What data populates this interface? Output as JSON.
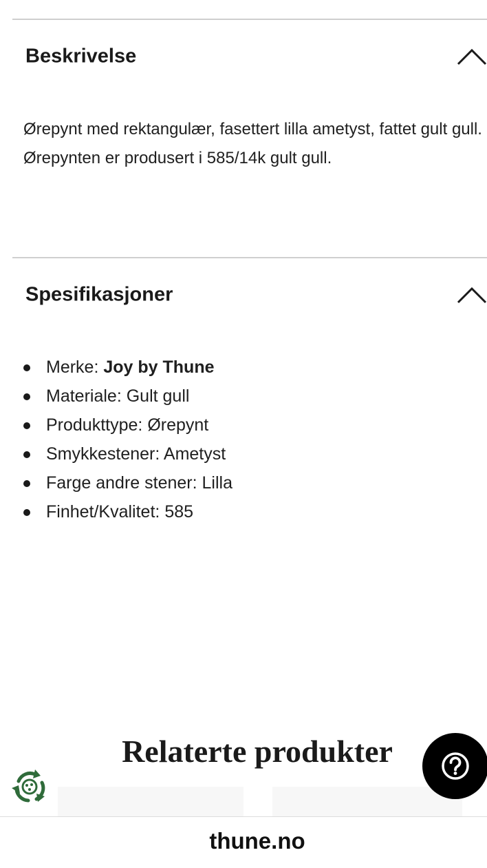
{
  "description": {
    "title": "Beskrivelse",
    "line1": "Ørepynt med rektangulær, fasettert lilla ametyst, fattet gult gull.",
    "line2": "Ørepynten er produsert i 585/14k gult gull."
  },
  "specifications": {
    "title": "Spesifikasjoner",
    "items": [
      {
        "label": "Merke: ",
        "value": "Joy by Thune"
      },
      {
        "label": "Materiale: ",
        "value": "Gult gull"
      },
      {
        "label": "Produkttype: ",
        "value": "Ørepynt"
      },
      {
        "label": "Smykkestener: ",
        "value": "Ametyst"
      },
      {
        "label": "Farge andre stener: ",
        "value": "Lilla"
      },
      {
        "label": "Finhet/Kvalitet: ",
        "value": "585"
      }
    ]
  },
  "related": {
    "title": "Relaterte produkter"
  },
  "browser": {
    "url": "thune.no"
  },
  "icons": {
    "collapse": "chevron-up-icon",
    "help": "question-mark-icon",
    "recycle": "recycle-icon"
  },
  "colors": {
    "recycle_green": "#2f6b3a",
    "help_button": "#000000",
    "divider": "#cfcfcf"
  }
}
